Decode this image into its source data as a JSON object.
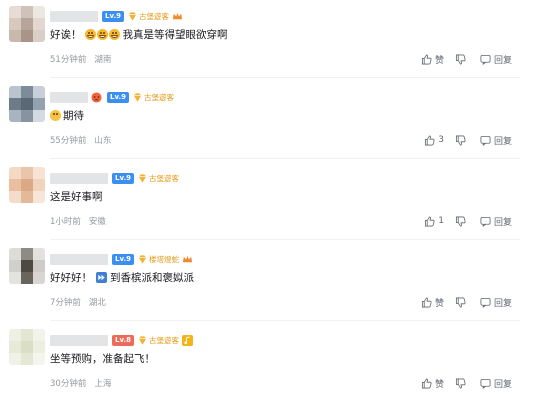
{
  "comments": [
    {
      "level": "Lv.9",
      "level_color": "#3b8ff0",
      "fan_badge": "古堡遊客",
      "content_text": "我真是等得望眼欲穿啊",
      "content_prefix": "好诶！",
      "time": "51分钟前",
      "location": "湖南",
      "like_label": "赞",
      "like_count": "",
      "reply_label": "回复"
    },
    {
      "level": "Lv.9",
      "level_color": "#3b8ff0",
      "fan_badge": "古堡遊客",
      "content_text": "期待",
      "time": "55分钟前",
      "location": "山东",
      "like_label": "",
      "like_count": "3",
      "reply_label": "回复"
    },
    {
      "level": "Lv.9",
      "level_color": "#3b8ff0",
      "fan_badge": "古堡遊客",
      "content_text": "这是好事啊",
      "time": "1小时前",
      "location": "安徽",
      "like_label": "",
      "like_count": "1",
      "reply_label": "回复"
    },
    {
      "level": "Lv.9",
      "level_color": "#3b8ff0",
      "fan_badge": "楼塔燈蛇",
      "content_prefix": "好好好！",
      "content_text": "到香槟派和褒姒派",
      "time": "7分钟前",
      "location": "湖北",
      "like_label": "赞",
      "like_count": "",
      "reply_label": "回复"
    },
    {
      "level": "Lv.8",
      "level_color": "#ef6a5b",
      "fan_badge": "古堡遊客",
      "content_text": "坐等预购，准备起飞！",
      "time": "30分钟前",
      "location": "上海",
      "like_label": "赞",
      "like_count": "",
      "reply_label": "回复"
    }
  ]
}
